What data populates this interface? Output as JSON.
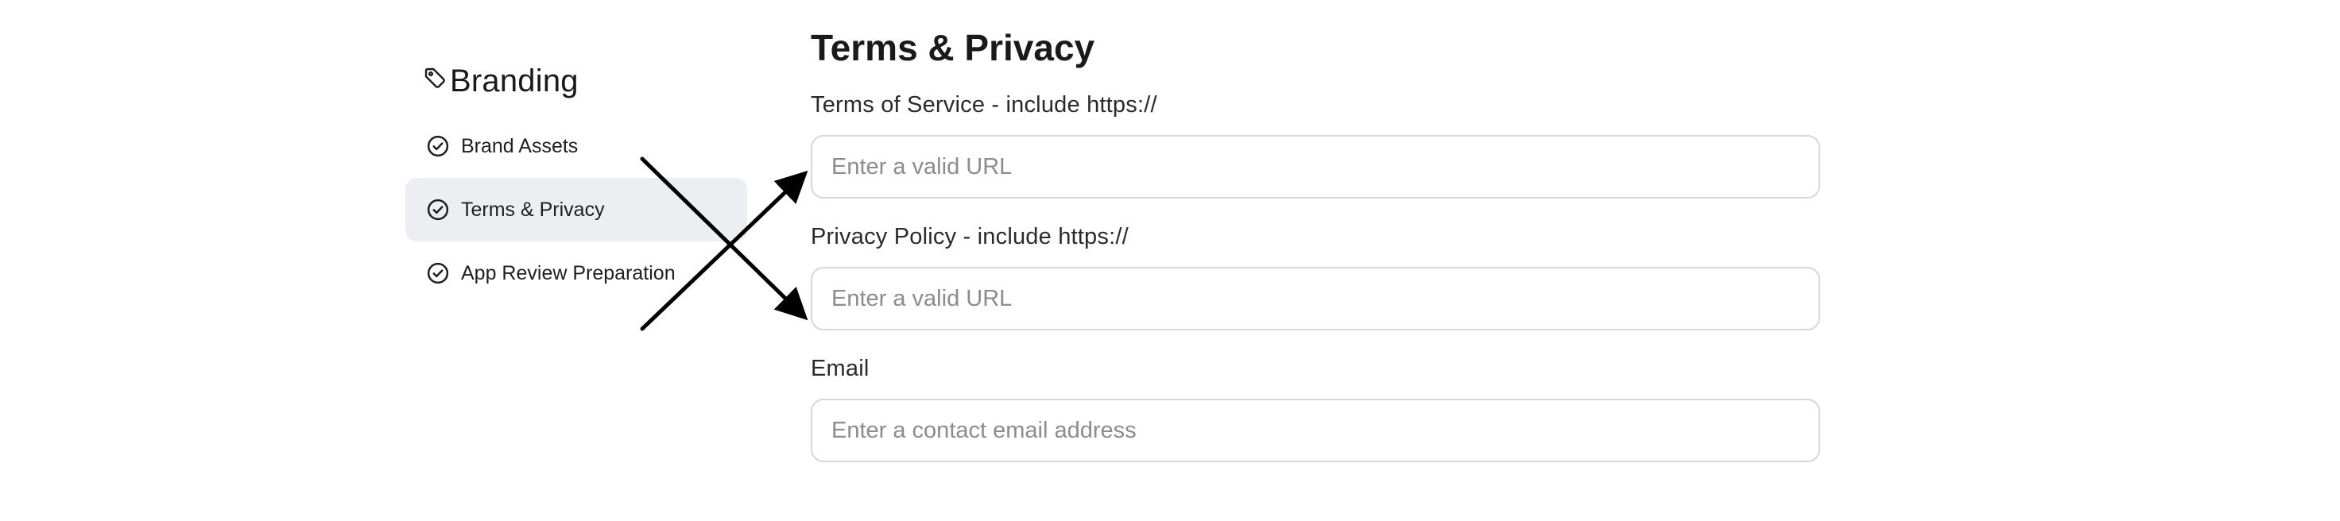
{
  "sidebar": {
    "title": "Branding",
    "title_icon": "tag-icon",
    "items": [
      {
        "label": "Brand Assets",
        "icon": "check-circle-icon",
        "active": false
      },
      {
        "label": "Terms & Privacy",
        "icon": "check-circle-icon",
        "active": true
      },
      {
        "label": "App Review Preparation",
        "icon": "check-circle-icon",
        "active": false
      }
    ]
  },
  "main": {
    "title": "Terms & Privacy",
    "fields": [
      {
        "label": "Terms of Service - include https://",
        "placeholder": "Enter a valid URL",
        "value": ""
      },
      {
        "label": "Privacy Policy - include https://",
        "placeholder": "Enter a valid URL",
        "value": ""
      },
      {
        "label": "Email",
        "placeholder": "Enter a contact email address",
        "value": ""
      }
    ]
  },
  "colors": {
    "active_item_bg": "#eceef1",
    "input_border": "#d6d7db",
    "placeholder": "#8b8b90",
    "arrow": "#000000"
  }
}
